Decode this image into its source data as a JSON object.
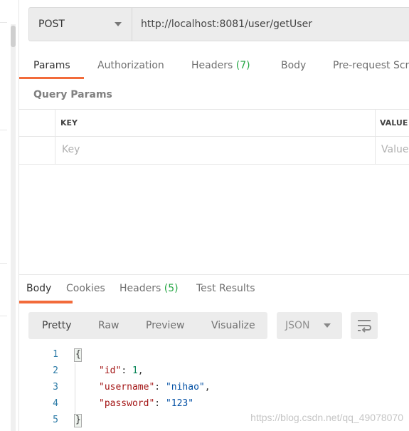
{
  "request": {
    "method": "POST",
    "url": "http://localhost:8081/user/getUser"
  },
  "request_tabs": [
    {
      "label": "Params",
      "active": true
    },
    {
      "label": "Authorization"
    },
    {
      "label": "Headers",
      "count": "(7)"
    },
    {
      "label": "Body"
    },
    {
      "label": "Pre-request Scr"
    }
  ],
  "params": {
    "title": "Query Params",
    "columns": [
      "KEY",
      "VALUE"
    ],
    "placeholders": [
      "Key",
      "Value"
    ]
  },
  "response_tabs": [
    {
      "label": "Body",
      "active": true
    },
    {
      "label": "Cookies"
    },
    {
      "label": "Headers",
      "count": "(5)"
    },
    {
      "label": "Test Results"
    }
  ],
  "view_modes": [
    "Pretty",
    "Raw",
    "Preview",
    "Visualize"
  ],
  "format": "JSON",
  "icons": {
    "wrap": "wrap-lines-icon",
    "method_caret": "chevron-down-icon"
  },
  "code_lines": [
    {
      "num": "1",
      "text": "{"
    },
    {
      "num": "2",
      "key": "\"id\"",
      "value": "1",
      "trail": ","
    },
    {
      "num": "3",
      "key": "\"username\"",
      "value": "\"nihao\"",
      "trail": ","
    },
    {
      "num": "4",
      "key": "\"password\"",
      "value": "\"123\"",
      "trail": ""
    },
    {
      "num": "5",
      "text": "}"
    }
  ],
  "watermark": "https://blog.csdn.net/qq_49078070",
  "colors": {
    "accent": "#f26b3a",
    "count": "#26a745"
  }
}
